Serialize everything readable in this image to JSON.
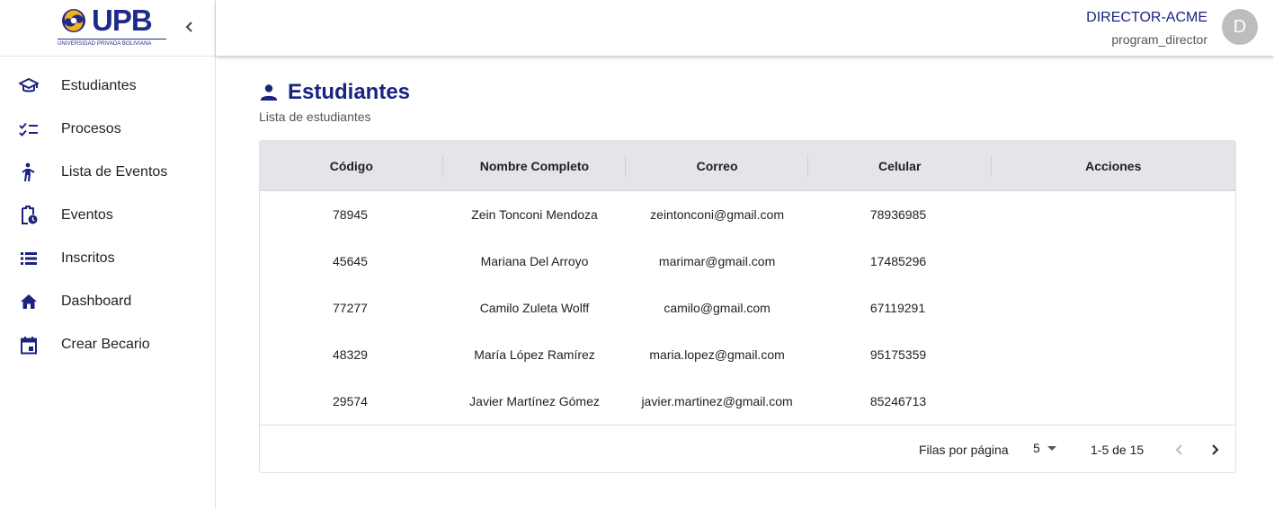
{
  "brand": {
    "logo_text": "UPB",
    "logo_subtitle": "UNIVERSIDAD PRIVADA BOLIVIANA",
    "colors": {
      "primary": "#1a237e",
      "accent": "#f2b01e"
    }
  },
  "sidebar": {
    "collapse_icon": "chevron-left-icon",
    "items": [
      {
        "label": "Estudiantes",
        "icon": "graduation-cap-icon"
      },
      {
        "label": "Procesos",
        "icon": "checklist-icon"
      },
      {
        "label": "Lista de Eventos",
        "icon": "person-walking-icon"
      },
      {
        "label": "Eventos",
        "icon": "clipboard-clock-icon"
      },
      {
        "label": "Inscritos",
        "icon": "list-icon"
      },
      {
        "label": "Dashboard",
        "icon": "home-icon"
      },
      {
        "label": "Crear Becario",
        "icon": "calendar-icon"
      }
    ]
  },
  "topbar": {
    "user_name": "DIRECTOR-ACME",
    "user_role": "program_director",
    "avatar_initial": "D"
  },
  "page": {
    "title": "Estudiantes",
    "subtitle": "Lista de estudiantes",
    "title_icon": "person-icon"
  },
  "table": {
    "columns": [
      "Código",
      "Nombre Completo",
      "Correo",
      "Celular",
      "Acciones"
    ],
    "rows": [
      [
        "78945",
        "Zein Tonconi Mendoza",
        "zeintonconi@gmail.com",
        "78936985",
        ""
      ],
      [
        "45645",
        "Mariana Del Arroyo",
        "marimar@gmail.com",
        "17485296",
        ""
      ],
      [
        "77277",
        "Camilo Zuleta Wolff",
        "camilo@gmail.com",
        "67119291",
        ""
      ],
      [
        "48329",
        "María López Ramírez",
        "maria.lopez@gmail.com",
        "95175359",
        ""
      ],
      [
        "29574",
        "Javier Martínez Gómez",
        "javier.martinez@gmail.com",
        "85246713",
        ""
      ]
    ],
    "footer": {
      "rows_per_page_label": "Filas por página",
      "rows_per_page_value": "5",
      "range_text": "1-5 de 15",
      "prev_icon": "chevron-left-icon",
      "next_icon": "chevron-right-icon"
    }
  }
}
